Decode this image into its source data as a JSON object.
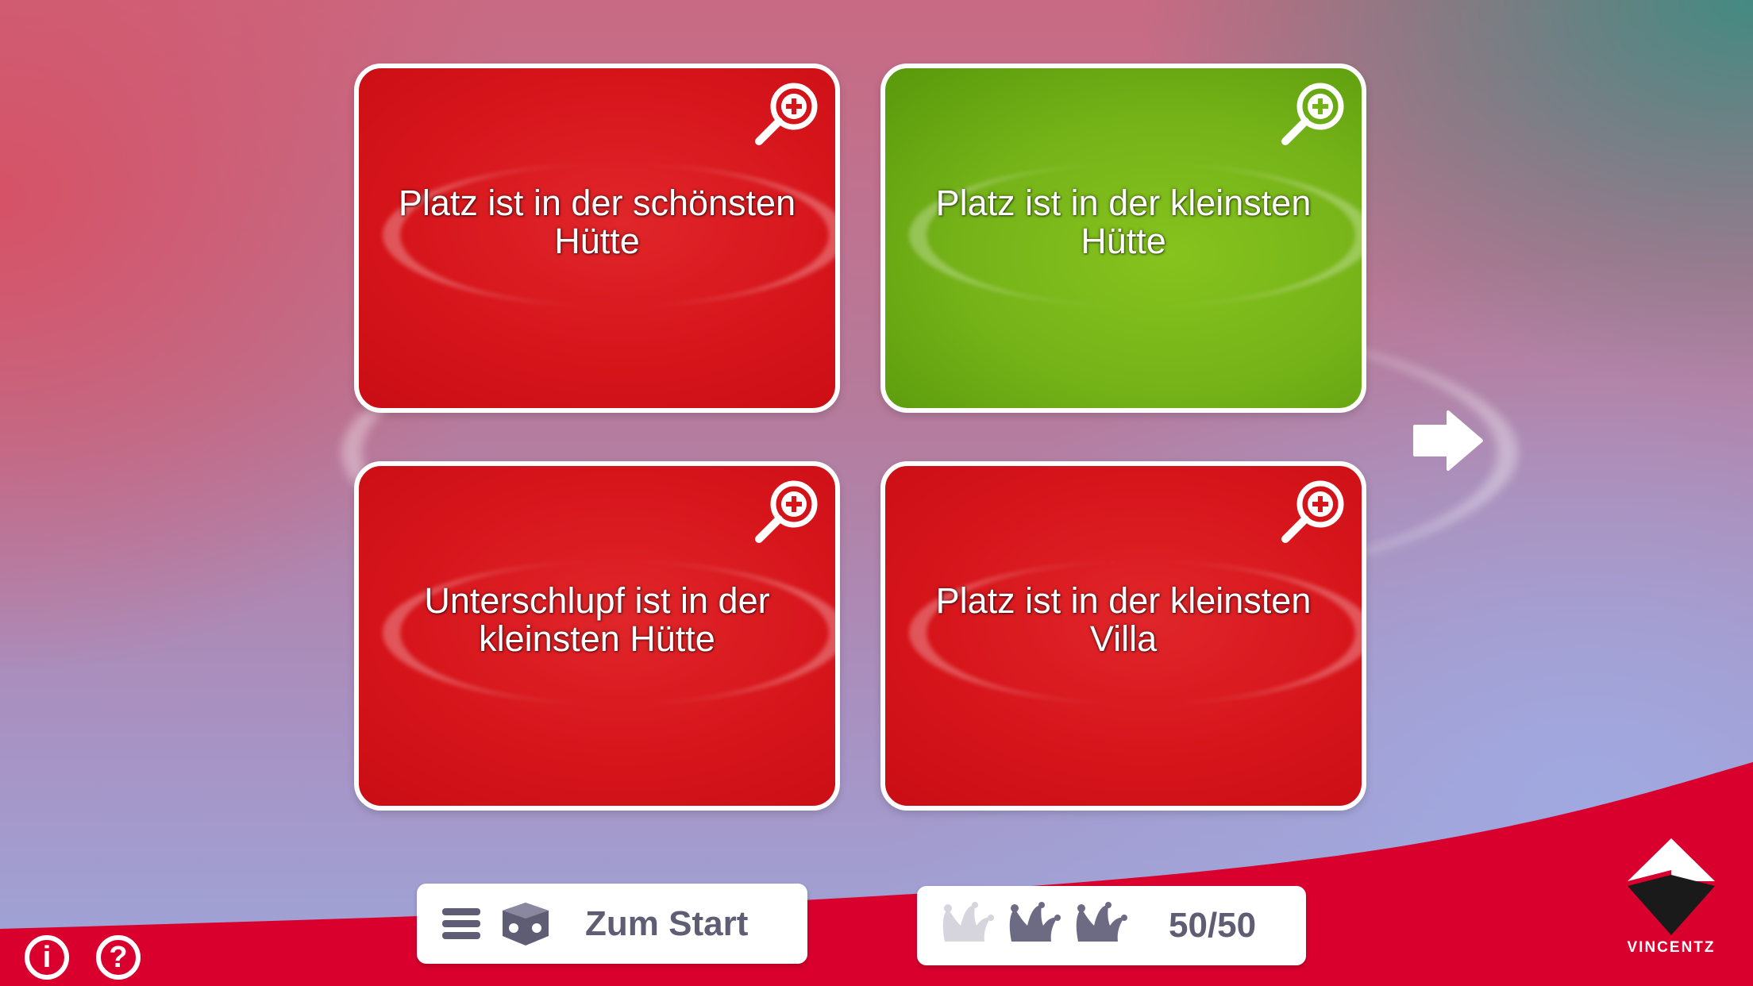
{
  "cards": [
    {
      "text": "Platz ist in der schönsten Hütte",
      "state": "red",
      "zoom_icon": "zoom-in-icon"
    },
    {
      "text": "Platz ist in der kleinsten Hütte",
      "state": "green",
      "zoom_icon": "zoom-in-icon"
    },
    {
      "text": "Unterschlupf ist in der kleinsten Hütte",
      "state": "red",
      "zoom_icon": "zoom-in-icon"
    },
    {
      "text": "Platz ist in der kleinsten Villa",
      "state": "red",
      "zoom_icon": "zoom-in-icon"
    }
  ],
  "navigation": {
    "next_icon": "arrow-right-icon",
    "start_label": "Zum Start",
    "start_icons": [
      "menu-icon",
      "dice-icon"
    ]
  },
  "jokers": {
    "icons": [
      "jester-hat-icon",
      "jester-hat-icon",
      "jester-hat-icon"
    ],
    "used": [
      true,
      false,
      false
    ],
    "score": "50/50"
  },
  "footer": {
    "info_icon": "info-icon",
    "help_icon": "help-icon",
    "info_glyph": "i",
    "help_glyph": "?",
    "brand": "VINCENTZ"
  },
  "colors": {
    "wrong": "#d6151b",
    "correct": "#74b218",
    "footer_band": "#d9002e",
    "button_text": "#5f5d74"
  }
}
